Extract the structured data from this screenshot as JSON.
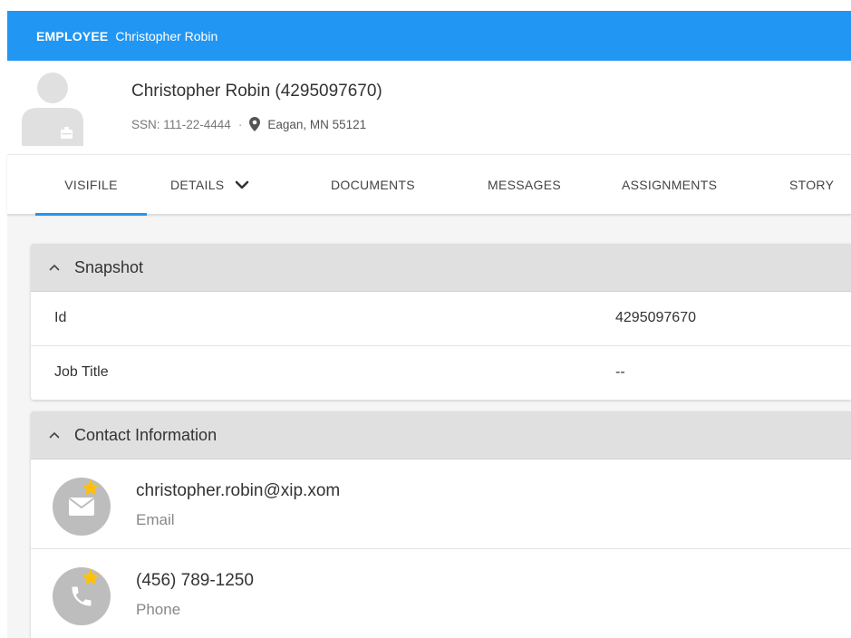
{
  "app_bar": {
    "kind": "EMPLOYEE",
    "name": "Christopher Robin"
  },
  "header": {
    "title": "Christopher Robin (4295097670)",
    "ssn": "SSN: 111-22-4444",
    "separator": "·",
    "location": "Eagan, MN 55121"
  },
  "tabs": [
    {
      "label": "VISIFILE",
      "active": true
    },
    {
      "label": "DETAILS",
      "has_dropdown": true
    },
    {
      "label": "DOCUMENTS"
    },
    {
      "label": "MESSAGES"
    },
    {
      "label": "ASSIGNMENTS"
    },
    {
      "label": "STORY"
    }
  ],
  "snapshot": {
    "title": "Snapshot",
    "rows": [
      {
        "key": "Id",
        "value": "4295097670"
      },
      {
        "key": "Job Title",
        "value": "--"
      }
    ]
  },
  "contact": {
    "title": "Contact Information",
    "items": [
      {
        "value": "christopher.robin@xip.xom",
        "type": "Email",
        "icon": "envelope-icon",
        "primary": true
      },
      {
        "value": "(456) 789-1250",
        "type": "Phone",
        "icon": "phone-icon",
        "primary": true
      }
    ]
  },
  "colors": {
    "accent": "#2196f3",
    "star": "#ffc107",
    "panel_head": "#e0e0e0",
    "icon_circle": "#bdbdbd"
  }
}
